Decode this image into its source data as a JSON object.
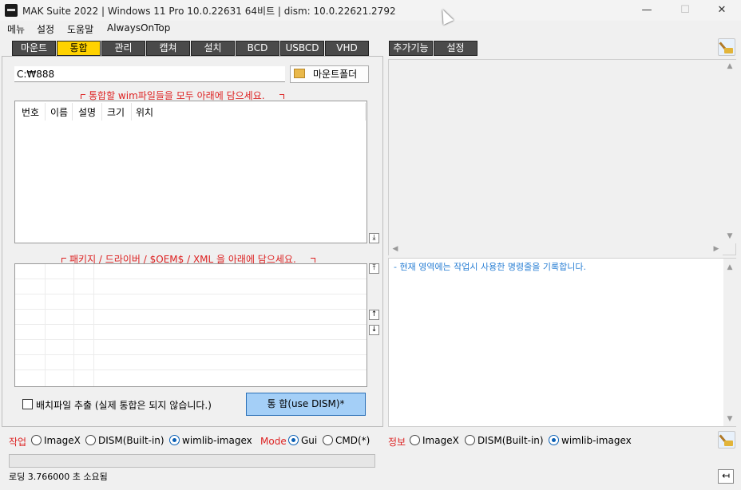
{
  "window": {
    "title": "MAK Suite 2022 | Windows 11 Pro 10.0.22631 64비트 | dism: 10.0.22621.2792",
    "minimize_glyph": "—",
    "maximize_glyph": "☐",
    "close_glyph": "✕"
  },
  "menu": [
    "메뉴",
    "설정",
    "도움말",
    "AlwaysOnTop"
  ],
  "left_tabs": [
    {
      "label": "마운트",
      "active": false
    },
    {
      "label": "통합",
      "active": true
    },
    {
      "label": "관리",
      "active": false
    },
    {
      "label": "캡쳐",
      "active": false
    },
    {
      "label": "설치",
      "active": false
    },
    {
      "label": "BCD",
      "active": false
    },
    {
      "label": "USBCD",
      "active": false
    },
    {
      "label": "VHD",
      "active": false
    }
  ],
  "right_tabs": [
    {
      "label": "추가기능"
    },
    {
      "label": "설정"
    }
  ],
  "integrate": {
    "path_value": "C:₩888",
    "mount_folder_label": "마운트폴더",
    "wim_hint": "통합할 wim파일들을 모두 아래에 담으세요.",
    "wim_columns": [
      "번호",
      "이름",
      "설명",
      "크기",
      "위치"
    ],
    "package_hint": "패키지 / 드라이버 / $OEM$ / XML 을 아래에 담으세요.",
    "batch_label": "배치파일 추출 (실제 통합은 되지 않습니다.)",
    "batch_checked": false,
    "integrate_button": "통 합(use DISM)*"
  },
  "log": {
    "text": "- 현재 영역에는 작업시 사용한 명령줄을 기록합니다."
  },
  "options_left": {
    "work_label": "작업",
    "work_options": [
      "ImageX",
      "DISM(Built-in)",
      "wimlib-imagex"
    ],
    "work_selected": 2,
    "mode_label": "Mode",
    "mode_options": [
      "Gui",
      "CMD(*)"
    ],
    "mode_selected": 0
  },
  "options_right": {
    "info_label": "정보",
    "info_options": [
      "ImageX",
      "DISM(Built-in)",
      "wimlib-imagex"
    ],
    "info_selected": 2
  },
  "status": {
    "text": "로딩 3.766000 초 소요됨",
    "progress": 0
  },
  "icons": {
    "app": "app-icon",
    "folder": "folder-icon",
    "broom": "broom-icon",
    "exit": "exit-icon"
  }
}
